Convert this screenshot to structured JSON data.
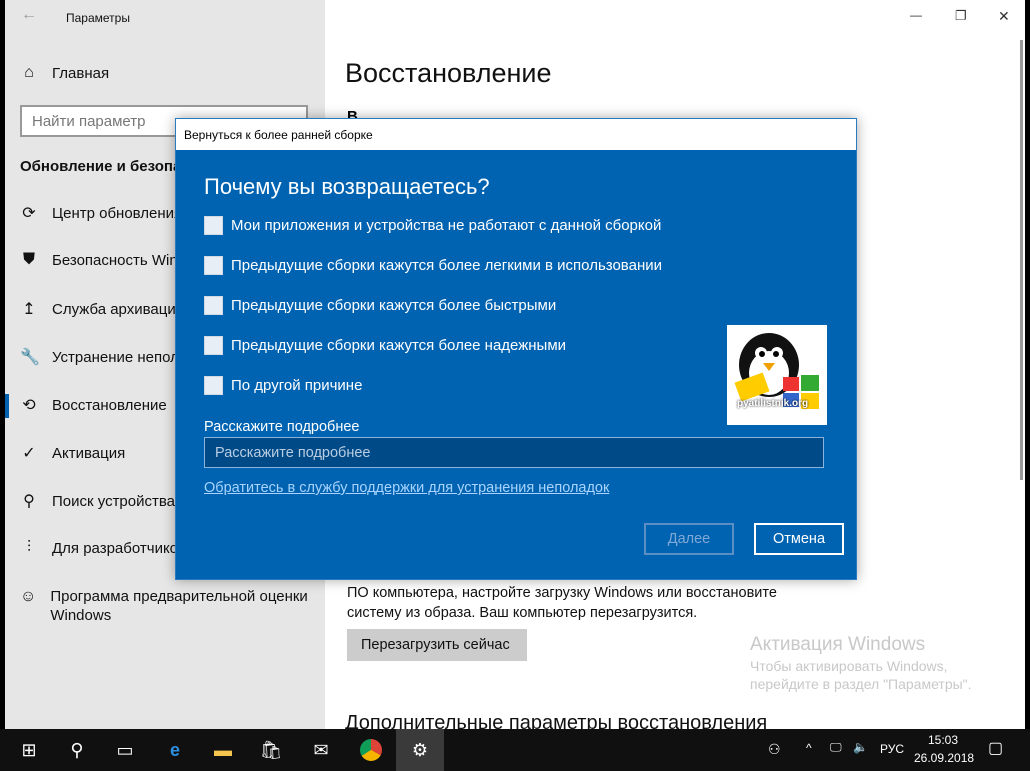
{
  "window": {
    "title": "Параметры",
    "minimize": "—",
    "maximize": "❐",
    "close": "✕"
  },
  "sidebar": {
    "home": "Главная",
    "search_placeholder": "Найти параметр",
    "section": "Обновление и безопа",
    "items": [
      {
        "label": "Центр обновления",
        "icon": "⟳"
      },
      {
        "label": "Безопасность Win",
        "icon": "⛊"
      },
      {
        "label": "Служба архивации",
        "icon": "↥"
      },
      {
        "label": "Устранение непол",
        "icon": "🔧"
      },
      {
        "label": "Восстановление",
        "icon": "⟲"
      },
      {
        "label": "Активация",
        "icon": "✓"
      },
      {
        "label": "Поиск устройства",
        "icon": "⚲"
      },
      {
        "label": "Для разработчико",
        "icon": "⫶"
      },
      {
        "label": "Программа предварительной оценки Windows",
        "icon": "☺"
      }
    ]
  },
  "main": {
    "title": "Восстановление",
    "partial": "В",
    "body": "ПО компьютера, настройте загрузку Windows или восстановите систему из образа. Ваш компьютер перезагрузится.",
    "restart_button": "Перезагрузить сейчас",
    "section2": "Дополнительные параметры восстановления"
  },
  "watermark": {
    "title": "Активация Windows",
    "line1": "Чтобы активировать Windows,",
    "line2": "перейдите в раздел \"Параметры\"."
  },
  "dialog": {
    "title": "Вернуться к более ранней сборке",
    "heading": "Почему вы возвращаетесь?",
    "options": [
      "Мои приложения и устройства не работают с данной сборкой",
      "Предыдущие сборки кажутся более легкими в использовании",
      "Предыдущие сборки кажутся более быстрыми",
      "Предыдущие сборки кажутся более надежными",
      "По другой причине"
    ],
    "details_label": "Расскажите подробнее",
    "details_placeholder": "Расскажите подробнее",
    "support_link": "Обратитесь в службу поддержки для устранения неполадок",
    "next": "Далее",
    "cancel": "Отмена",
    "logo_text": "pyatilistnik.org"
  },
  "taskbar": {
    "lang": "РУС",
    "time": "15:03",
    "date": "26.09.2018"
  }
}
